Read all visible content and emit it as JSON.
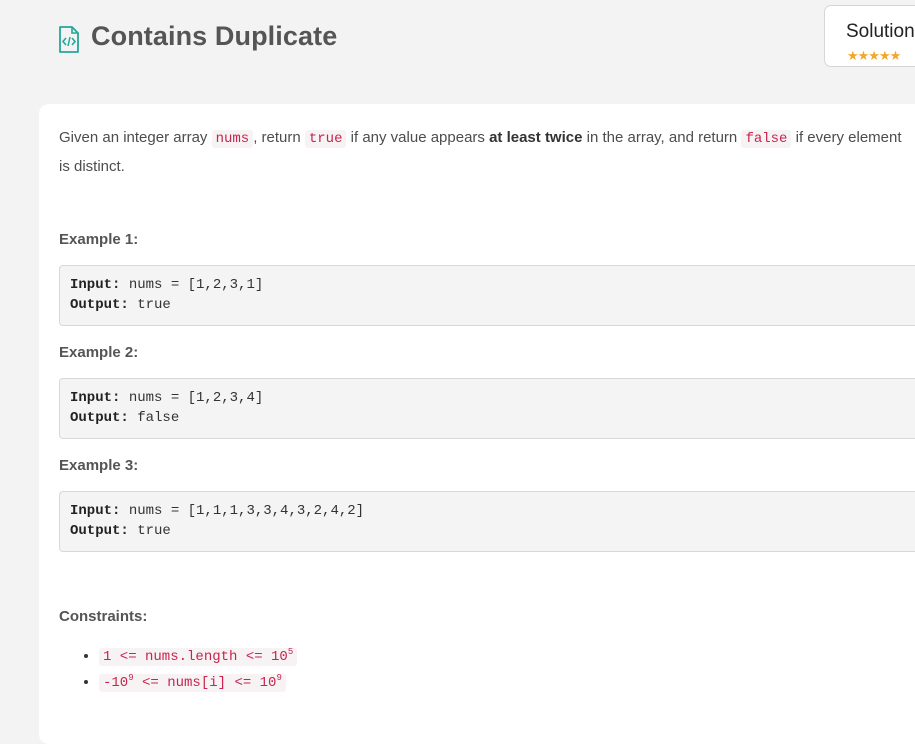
{
  "header": {
    "title": "Contains Duplicate",
    "solution_label": "Solution",
    "stars": "★★★★★"
  },
  "description": {
    "p1": "Given an integer array ",
    "code1": "nums",
    "p2": ", return ",
    "code2": "true",
    "p3": " if any value appears ",
    "bold": "at least twice",
    "p4": " in the array, and return ",
    "code3": "false",
    "p5": " if every element is distinct."
  },
  "examples": [
    {
      "title": "Example 1:",
      "input_label": "Input:",
      "input": " nums = [1,2,3,1]",
      "output_label": "Output:",
      "output": " true"
    },
    {
      "title": "Example 2:",
      "input_label": "Input:",
      "input": " nums = [1,2,3,4]",
      "output_label": "Output:",
      "output": " false"
    },
    {
      "title": "Example 3:",
      "input_label": "Input:",
      "input": " nums = [1,1,1,3,3,4,3,2,4,2]",
      "output_label": "Output:",
      "output": " true"
    }
  ],
  "constraints": {
    "title": "Constraints:",
    "c1_a": "1 <= nums.length <= 10",
    "c1_sup": "5",
    "c2_a": "-10",
    "c2_sup1": "9",
    "c2_b": " <= nums[i] <= 10",
    "c2_sup2": "9"
  },
  "colors": {
    "accent_icon": "#26a69a",
    "inline_code": "#c7254e",
    "stars": "#f5a623"
  }
}
